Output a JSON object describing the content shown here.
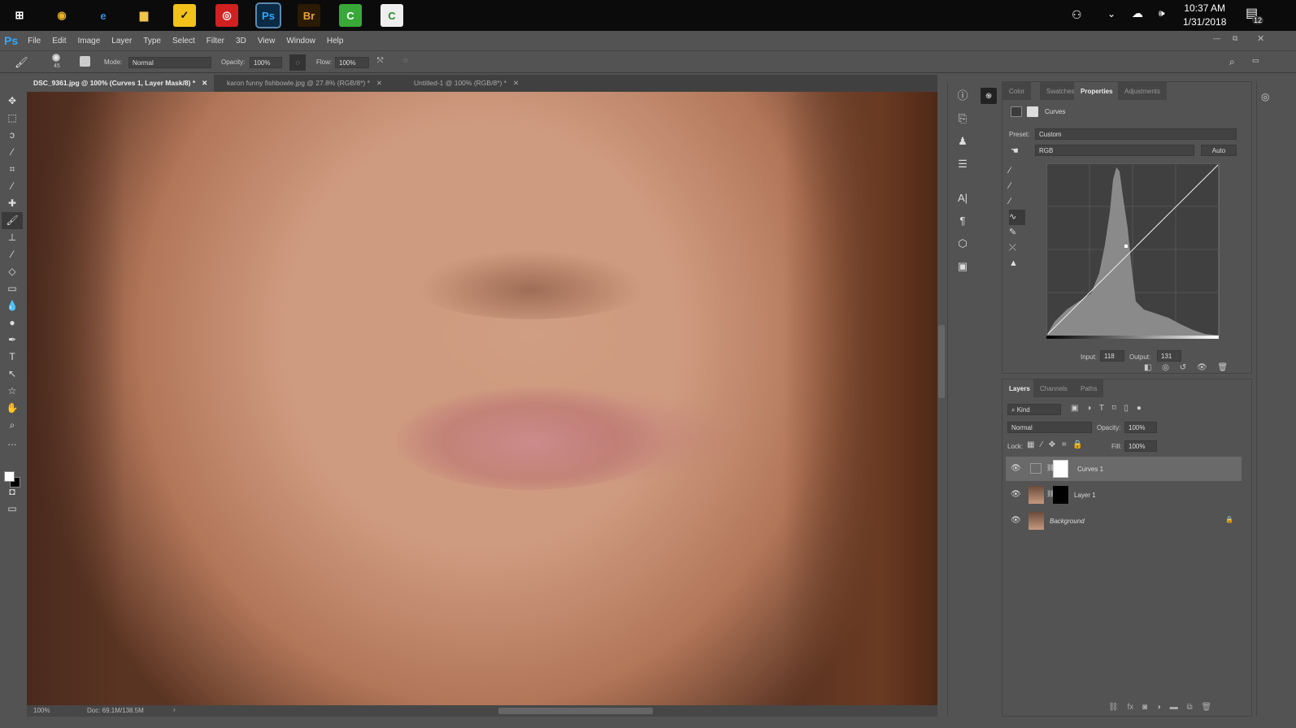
{
  "taskbar": {
    "apps": [
      {
        "name": "start",
        "label": "⊞",
        "bg": "#0b0b0b",
        "fg": "#fff"
      },
      {
        "name": "chrome",
        "label": "◉",
        "bg": "#0b0b0b",
        "fg": "#e8b32a"
      },
      {
        "name": "edge",
        "label": "e",
        "bg": "#0b0b0b",
        "fg": "#2f8fe0"
      },
      {
        "name": "file-explorer",
        "label": "▆",
        "bg": "#0b0b0b",
        "fg": "#f1c34a"
      },
      {
        "name": "norton",
        "label": "✓",
        "bg": "#f2c21b",
        "fg": "#111"
      },
      {
        "name": "app-red",
        "label": "◎",
        "bg": "#d02020",
        "fg": "#fff"
      },
      {
        "name": "photoshop",
        "label": "Ps",
        "bg": "#0b2a44",
        "fg": "#31a8ff"
      },
      {
        "name": "bridge",
        "label": "Br",
        "bg": "#2b1a04",
        "fg": "#e8a23a"
      },
      {
        "name": "camtasia",
        "label": "C",
        "bg": "#38a838",
        "fg": "#fff"
      },
      {
        "name": "camtasia-2",
        "label": "C",
        "bg": "#eee",
        "fg": "#2a8a2a"
      }
    ],
    "time": "10:37 AM",
    "date": "1/31/2018",
    "notifications": "12"
  },
  "menu": {
    "logo": "Ps",
    "items": [
      "File",
      "Edit",
      "Image",
      "Layer",
      "Type",
      "Select",
      "Filter",
      "3D",
      "View",
      "Window",
      "Help"
    ]
  },
  "options": {
    "brush_size": "45",
    "mode_label": "Mode:",
    "mode": "Normal",
    "opacity_label": "Opacity:",
    "opacity": "100%",
    "flow_label": "Flow:",
    "flow": "100%"
  },
  "tabs": [
    {
      "label": "DSC_9361.jpg @ 100% (Curves 1, Layer Mask/8) *"
    },
    {
      "label": "karon funny fishbowle.jpg @ 27.8% (RGB/8*) *"
    },
    {
      "label": "Untitled-1 @ 100% (RGB/8*) *"
    }
  ],
  "status": {
    "zoom": "100%",
    "doc": "Doc: 69.1M/138.5M"
  },
  "properties": {
    "tabs": [
      "Color",
      "Swatches",
      "Properties",
      "Adjustments"
    ],
    "title": "Curves",
    "preset_label": "Preset:",
    "preset": "Custom",
    "channel": "RGB",
    "auto": "Auto",
    "input_label": "Input:",
    "input": "118",
    "output_label": "Output:",
    "output": "131"
  },
  "layers": {
    "tabs": [
      "Layers",
      "Channels",
      "Paths"
    ],
    "kind": "Kind",
    "blend": "Normal",
    "opacity_label": "Opacity:",
    "opacity": "100%",
    "lock_label": "Lock:",
    "fill_label": "Fill:",
    "fill": "100%",
    "items": [
      {
        "name": "Curves 1"
      },
      {
        "name": "Layer 1"
      },
      {
        "name": "Background"
      }
    ]
  }
}
